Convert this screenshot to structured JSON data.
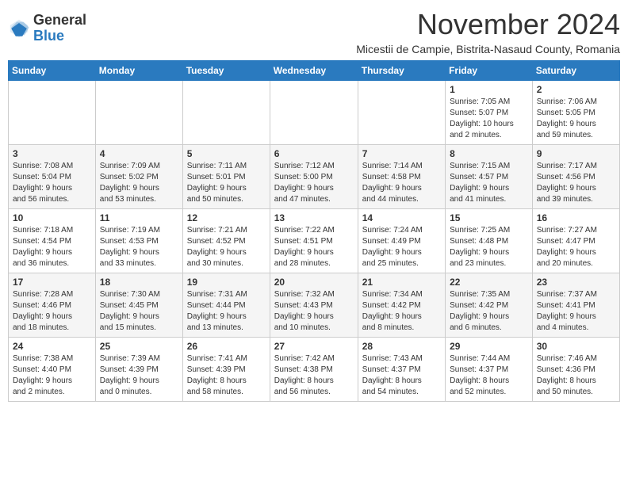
{
  "header": {
    "logo_general": "General",
    "logo_blue": "Blue",
    "month_title": "November 2024",
    "subtitle": "Micestii de Campie, Bistrita-Nasaud County, Romania"
  },
  "weekdays": [
    "Sunday",
    "Monday",
    "Tuesday",
    "Wednesday",
    "Thursday",
    "Friday",
    "Saturday"
  ],
  "weeks": [
    [
      {
        "day": "",
        "info": ""
      },
      {
        "day": "",
        "info": ""
      },
      {
        "day": "",
        "info": ""
      },
      {
        "day": "",
        "info": ""
      },
      {
        "day": "",
        "info": ""
      },
      {
        "day": "1",
        "info": "Sunrise: 7:05 AM\nSunset: 5:07 PM\nDaylight: 10 hours\nand 2 minutes."
      },
      {
        "day": "2",
        "info": "Sunrise: 7:06 AM\nSunset: 5:05 PM\nDaylight: 9 hours\nand 59 minutes."
      }
    ],
    [
      {
        "day": "3",
        "info": "Sunrise: 7:08 AM\nSunset: 5:04 PM\nDaylight: 9 hours\nand 56 minutes."
      },
      {
        "day": "4",
        "info": "Sunrise: 7:09 AM\nSunset: 5:02 PM\nDaylight: 9 hours\nand 53 minutes."
      },
      {
        "day": "5",
        "info": "Sunrise: 7:11 AM\nSunset: 5:01 PM\nDaylight: 9 hours\nand 50 minutes."
      },
      {
        "day": "6",
        "info": "Sunrise: 7:12 AM\nSunset: 5:00 PM\nDaylight: 9 hours\nand 47 minutes."
      },
      {
        "day": "7",
        "info": "Sunrise: 7:14 AM\nSunset: 4:58 PM\nDaylight: 9 hours\nand 44 minutes."
      },
      {
        "day": "8",
        "info": "Sunrise: 7:15 AM\nSunset: 4:57 PM\nDaylight: 9 hours\nand 41 minutes."
      },
      {
        "day": "9",
        "info": "Sunrise: 7:17 AM\nSunset: 4:56 PM\nDaylight: 9 hours\nand 39 minutes."
      }
    ],
    [
      {
        "day": "10",
        "info": "Sunrise: 7:18 AM\nSunset: 4:54 PM\nDaylight: 9 hours\nand 36 minutes."
      },
      {
        "day": "11",
        "info": "Sunrise: 7:19 AM\nSunset: 4:53 PM\nDaylight: 9 hours\nand 33 minutes."
      },
      {
        "day": "12",
        "info": "Sunrise: 7:21 AM\nSunset: 4:52 PM\nDaylight: 9 hours\nand 30 minutes."
      },
      {
        "day": "13",
        "info": "Sunrise: 7:22 AM\nSunset: 4:51 PM\nDaylight: 9 hours\nand 28 minutes."
      },
      {
        "day": "14",
        "info": "Sunrise: 7:24 AM\nSunset: 4:49 PM\nDaylight: 9 hours\nand 25 minutes."
      },
      {
        "day": "15",
        "info": "Sunrise: 7:25 AM\nSunset: 4:48 PM\nDaylight: 9 hours\nand 23 minutes."
      },
      {
        "day": "16",
        "info": "Sunrise: 7:27 AM\nSunset: 4:47 PM\nDaylight: 9 hours\nand 20 minutes."
      }
    ],
    [
      {
        "day": "17",
        "info": "Sunrise: 7:28 AM\nSunset: 4:46 PM\nDaylight: 9 hours\nand 18 minutes."
      },
      {
        "day": "18",
        "info": "Sunrise: 7:30 AM\nSunset: 4:45 PM\nDaylight: 9 hours\nand 15 minutes."
      },
      {
        "day": "19",
        "info": "Sunrise: 7:31 AM\nSunset: 4:44 PM\nDaylight: 9 hours\nand 13 minutes."
      },
      {
        "day": "20",
        "info": "Sunrise: 7:32 AM\nSunset: 4:43 PM\nDaylight: 9 hours\nand 10 minutes."
      },
      {
        "day": "21",
        "info": "Sunrise: 7:34 AM\nSunset: 4:42 PM\nDaylight: 9 hours\nand 8 minutes."
      },
      {
        "day": "22",
        "info": "Sunrise: 7:35 AM\nSunset: 4:42 PM\nDaylight: 9 hours\nand 6 minutes."
      },
      {
        "day": "23",
        "info": "Sunrise: 7:37 AM\nSunset: 4:41 PM\nDaylight: 9 hours\nand 4 minutes."
      }
    ],
    [
      {
        "day": "24",
        "info": "Sunrise: 7:38 AM\nSunset: 4:40 PM\nDaylight: 9 hours\nand 2 minutes."
      },
      {
        "day": "25",
        "info": "Sunrise: 7:39 AM\nSunset: 4:39 PM\nDaylight: 9 hours\nand 0 minutes."
      },
      {
        "day": "26",
        "info": "Sunrise: 7:41 AM\nSunset: 4:39 PM\nDaylight: 8 hours\nand 58 minutes."
      },
      {
        "day": "27",
        "info": "Sunrise: 7:42 AM\nSunset: 4:38 PM\nDaylight: 8 hours\nand 56 minutes."
      },
      {
        "day": "28",
        "info": "Sunrise: 7:43 AM\nSunset: 4:37 PM\nDaylight: 8 hours\nand 54 minutes."
      },
      {
        "day": "29",
        "info": "Sunrise: 7:44 AM\nSunset: 4:37 PM\nDaylight: 8 hours\nand 52 minutes."
      },
      {
        "day": "30",
        "info": "Sunrise: 7:46 AM\nSunset: 4:36 PM\nDaylight: 8 hours\nand 50 minutes."
      }
    ]
  ]
}
